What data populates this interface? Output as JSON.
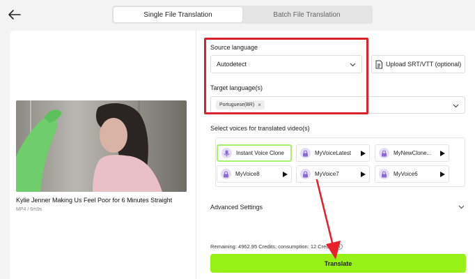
{
  "tabs": [
    {
      "label": "Single File Translation",
      "active": true
    },
    {
      "label": "Batch File Translation",
      "active": false
    }
  ],
  "video": {
    "title": "Kylie Jenner Making Us Feel Poor for 6 Minutes Straight",
    "meta": "MP4 / 6m9s"
  },
  "source_language": {
    "label": "Source language",
    "value": "Autodetect"
  },
  "upload": {
    "label": "Upload SRT/VTT (optional)"
  },
  "target_language": {
    "label": "Target language(s)",
    "chips": [
      "Portuguese(BR)"
    ],
    "remove_symbol": "×"
  },
  "voices": {
    "label": "Select voices for translated video(s)",
    "items": [
      {
        "name": "Instant Voice Clone",
        "selected": true,
        "icon": "microphone-icon"
      },
      {
        "name": "MyVoiceLatest",
        "selected": false,
        "icon": "lock-icon"
      },
      {
        "name": "MyNewClone...",
        "selected": false,
        "icon": "lock-icon"
      },
      {
        "name": "MyVoice8",
        "selected": false,
        "icon": "lock-icon"
      },
      {
        "name": "MyVoice7",
        "selected": false,
        "icon": "lock-icon"
      },
      {
        "name": "MyVoice6",
        "selected": false,
        "icon": "lock-icon"
      }
    ]
  },
  "advanced": {
    "label": "Advanced Settings"
  },
  "credits": {
    "text": "Remaining: 4962.95 Credits; consumption: 12 Credits"
  },
  "translate": {
    "label": "Translate"
  },
  "colors": {
    "accent_green": "#96f216",
    "selected_border": "#a7f36b",
    "highlight_red": "#d9222a",
    "arrow_red": "#e8202a"
  }
}
